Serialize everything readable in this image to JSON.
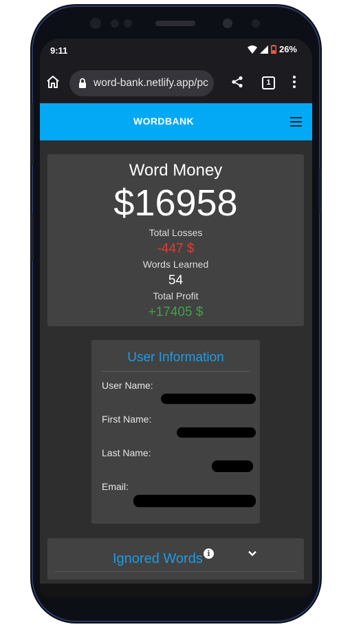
{
  "status_bar": {
    "time": "9:11",
    "battery": "26%"
  },
  "browser": {
    "url": "word-bank.netlify.app/pc",
    "tab_count": "1"
  },
  "header": {
    "title": "WORDBANK"
  },
  "money": {
    "title": "Word Money",
    "amount": "$16958",
    "losses_label": "Total Losses",
    "losses_value": "-447 $",
    "words_label": "Words Learned",
    "words_value": "54",
    "profit_label": "Total Profit",
    "profit_value": "+17405 $"
  },
  "user_info": {
    "title": "User Information",
    "user_name_label": "User Name:",
    "first_name_label": "First Name:",
    "last_name_label": "Last Name:",
    "email_label": "Email:"
  },
  "ignored": {
    "title": "Ignored Words",
    "info_glyph": "i"
  },
  "colors": {
    "accent": "#03a9f4",
    "link": "#1e9be3",
    "loss": "#e53935",
    "profit": "#43a047",
    "card": "#424242",
    "background": "#2e2e2e"
  }
}
